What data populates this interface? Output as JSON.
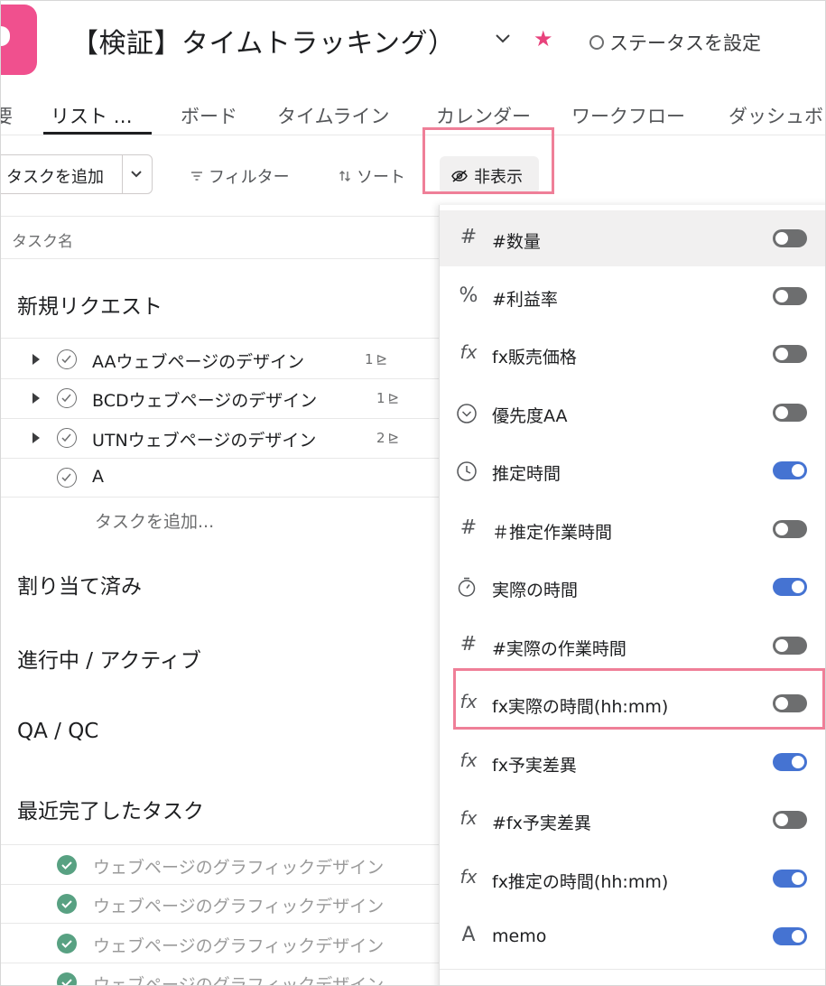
{
  "header": {
    "project_title": "【検証】タイムトラッキング）",
    "status_label": "ステータスを設定"
  },
  "tabs": [
    {
      "label": "要"
    },
    {
      "label": "リスト …"
    },
    {
      "label": "ボード"
    },
    {
      "label": "タイムライン"
    },
    {
      "label": "カレンダー"
    },
    {
      "label": "ワークフロー"
    },
    {
      "label": "ダッシュボ"
    }
  ],
  "toolbar": {
    "add_task": "タスクを追加",
    "filter": "フィルター",
    "sort": "ソート",
    "hide": "非表示"
  },
  "list": {
    "column_header": "タスク名",
    "sections": {
      "new_request": "新規リクエスト",
      "assigned": "割り当て済み",
      "in_progress": "進行中 / アクティブ",
      "qa": "QA / QC",
      "recent_done": "最近完了したタスク"
    },
    "tasks": [
      {
        "name": "AAウェブページのデザイン",
        "subtasks": "1"
      },
      {
        "name": "BCDウェブページのデザイン",
        "subtasks": "1"
      },
      {
        "name": "UTNウェブページのデザイン",
        "subtasks": "2"
      },
      {
        "name": "A"
      }
    ],
    "add_task_link": "タスクを追加...",
    "done_tasks": [
      {
        "name": "ウェブページのグラフィックデザイン"
      },
      {
        "name": "ウェブページのグラフィックデザイン"
      },
      {
        "name": "ウェブページのグラフィックデザイン"
      },
      {
        "name": "ウェブページのグラフィックデザイン"
      }
    ]
  },
  "fields_panel": {
    "items": [
      {
        "icon": "hash-icon",
        "glyph": "#",
        "label": "#数量",
        "on": false
      },
      {
        "icon": "percent-icon",
        "glyph": "%",
        "label": "#利益率",
        "on": false
      },
      {
        "icon": "formula-icon",
        "glyph": "fx",
        "label": "fx販売価格",
        "on": false
      },
      {
        "icon": "dropdown-circle-icon",
        "glyph": "⌄",
        "label": "優先度AA",
        "on": false
      },
      {
        "icon": "clock-icon",
        "glyph": "◷",
        "label": "推定時間",
        "on": true
      },
      {
        "icon": "hash-icon",
        "glyph": "#",
        "label": "＃推定作業時間",
        "on": false
      },
      {
        "icon": "stopwatch-icon",
        "glyph": "⏱",
        "label": "実際の時間",
        "on": true
      },
      {
        "icon": "hash-icon",
        "glyph": "#",
        "label": "#実際の作業時間",
        "on": false
      },
      {
        "icon": "formula-icon",
        "glyph": "fx",
        "label": "fx実際の時間(hh:mm)",
        "on": false
      },
      {
        "icon": "formula-icon",
        "glyph": "fx",
        "label": "fx予実差異",
        "on": true
      },
      {
        "icon": "formula-icon",
        "glyph": "fx",
        "label": "#fx予実差異",
        "on": false
      },
      {
        "icon": "formula-icon",
        "glyph": "fx",
        "label": "fx推定の時間(hh:mm)",
        "on": true
      },
      {
        "icon": "text-icon",
        "glyph": "A",
        "label": "memo",
        "on": true
      }
    ]
  },
  "colors": {
    "brand_pink": "#f0508e",
    "toggle_on": "#4573d2",
    "toggle_off": "#6d6e6f",
    "done_green": "#58a182",
    "highlight_box": "#ef7f98"
  }
}
